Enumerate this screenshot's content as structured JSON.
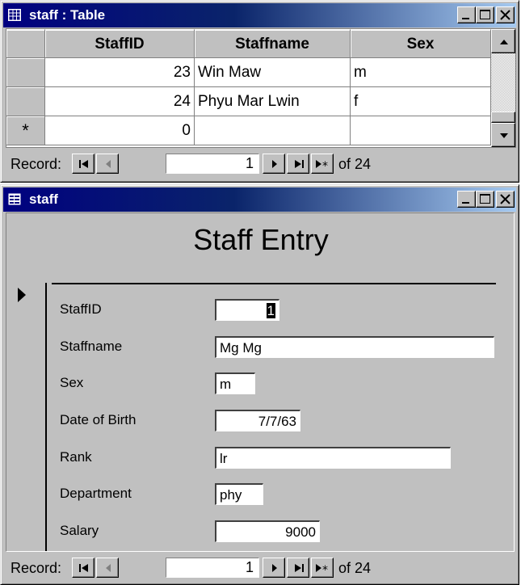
{
  "table_window": {
    "title": "staff : Table",
    "columns": [
      "StaffID",
      "Staffname",
      "Sex"
    ],
    "rows": [
      {
        "id": "23",
        "name": "Win Maw",
        "sex": "m"
      },
      {
        "id": "24",
        "name": "Phyu Mar Lwin",
        "sex": "f"
      }
    ],
    "new_row": {
      "marker": "*",
      "id": "0"
    },
    "nav": {
      "label": "Record:",
      "current": "1",
      "total": "of 24"
    }
  },
  "form_window": {
    "title": "staff",
    "heading": "Staff Entry",
    "fields": {
      "staffid": {
        "label": "StaffID",
        "value": "1"
      },
      "staffname": {
        "label": "Staffname",
        "value": "Mg Mg"
      },
      "sex": {
        "label": "Sex",
        "value": "m"
      },
      "dob": {
        "label": "Date of Birth",
        "value": "7/7/63"
      },
      "rank": {
        "label": "Rank",
        "value": "lr"
      },
      "department": {
        "label": "Department",
        "value": "phy"
      },
      "salary": {
        "label": "Salary",
        "value": "9000"
      }
    },
    "nav": {
      "label": "Record:",
      "current": "1",
      "total": "of 24"
    }
  }
}
